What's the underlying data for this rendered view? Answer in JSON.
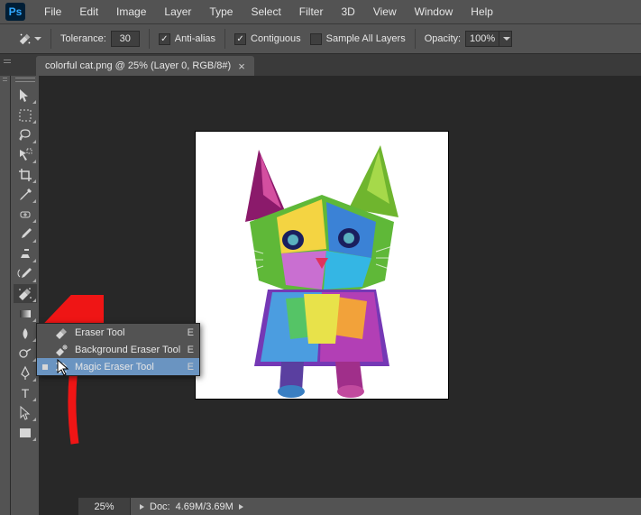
{
  "menu": [
    "File",
    "Edit",
    "Image",
    "Layer",
    "Type",
    "Select",
    "Filter",
    "3D",
    "View",
    "Window",
    "Help"
  ],
  "options": {
    "tolerance_label": "Tolerance:",
    "tolerance_value": "30",
    "anti_alias": "Anti-alias",
    "anti_alias_checked": true,
    "contiguous": "Contiguous",
    "contiguous_checked": true,
    "sample_all": "Sample All Layers",
    "sample_all_checked": false,
    "opacity_label": "Opacity:",
    "opacity_value": "100%"
  },
  "tab": {
    "title": "colorful cat.png @ 25% (Layer 0, RGB/8#)"
  },
  "tools": [
    {
      "name": "move-tool"
    },
    {
      "name": "marquee-tool"
    },
    {
      "name": "lasso-tool"
    },
    {
      "name": "quick-select-tool"
    },
    {
      "name": "crop-tool"
    },
    {
      "name": "eyedropper-tool"
    },
    {
      "name": "healing-brush-tool"
    },
    {
      "name": "brush-tool"
    },
    {
      "name": "clone-stamp-tool"
    },
    {
      "name": "history-brush-tool"
    },
    {
      "name": "eraser-tool",
      "active": true
    },
    {
      "name": "gradient-tool"
    },
    {
      "name": "blur-tool"
    },
    {
      "name": "dodge-tool"
    },
    {
      "name": "pen-tool"
    },
    {
      "name": "type-tool"
    },
    {
      "name": "path-select-tool"
    },
    {
      "name": "rectangle-tool"
    }
  ],
  "flyout": {
    "items": [
      {
        "label": "Eraser Tool",
        "key": "E",
        "icon": "eraser",
        "selected": false
      },
      {
        "label": "Background Eraser Tool",
        "key": "E",
        "icon": "bg-eraser",
        "selected": false
      },
      {
        "label": "Magic Eraser Tool",
        "key": "E",
        "icon": "magic-eraser",
        "selected": true,
        "current": true
      }
    ]
  },
  "status": {
    "zoom": "25%",
    "doc_label": "Doc:",
    "doc_value": "4.69M/3.69M"
  }
}
